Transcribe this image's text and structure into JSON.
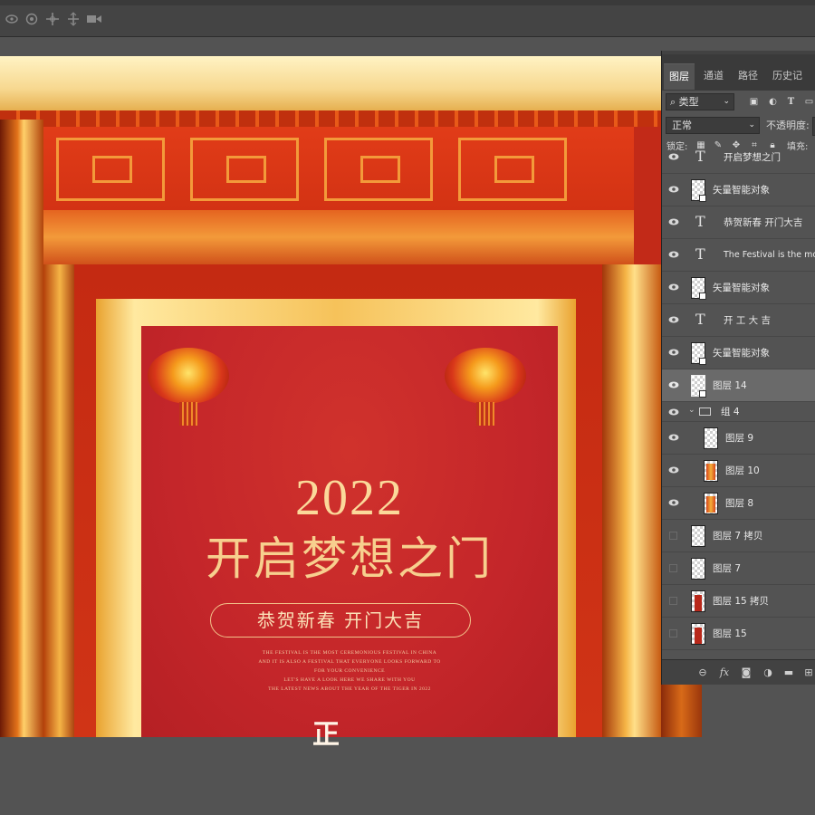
{
  "toolbar": {
    "icons": [
      "3d-orbit-icon",
      "3d-roll-icon",
      "3d-pan-icon",
      "3d-slide-icon",
      "3d-camera-icon"
    ]
  },
  "poster": {
    "year": "2022",
    "headline": "开启梦想之门",
    "subtitle": "恭贺新春  开门大吉",
    "small_copy": [
      "THE FESTIVAL IS THE MOST CEREMONIOUS FESTIVAL IN CHINA",
      "AND IT IS ALSO A FESTIVAL THAT EVERYONE LOOKS FORWARD TO",
      "FOR YOUR CONVENIENCE",
      "LET'S HAVE A LOOK HERE WE SHARE WITH YOU",
      "THE LATEST NEWS ABOUT THE YEAR OF THE TIGER IN 2022"
    ],
    "seal_char": "正"
  },
  "layers_panel": {
    "tabs": [
      "图层",
      "通道",
      "路径",
      "历史记录"
    ],
    "active_tab": "图层",
    "filter_kind": "类型",
    "blend_mode": "正常",
    "opacity_label": "不透明度:",
    "lock_label": "锁定:",
    "fill_label": "填充:",
    "layers": [
      {
        "type": "text",
        "name": "开启梦想之门",
        "visible": true
      },
      {
        "type": "smart",
        "name": "矢量智能对象",
        "visible": true
      },
      {
        "type": "text",
        "name": "恭贺新春 开门大吉",
        "visible": true
      },
      {
        "type": "text",
        "name": "The Festival is the mos",
        "visible": true
      },
      {
        "type": "smart",
        "name": "矢量智能对象",
        "visible": true
      },
      {
        "type": "text",
        "name": "开 工 大 吉",
        "visible": true
      },
      {
        "type": "smart",
        "name": "矢量智能对象",
        "visible": true
      },
      {
        "type": "smart",
        "name": "图层 14",
        "visible": true,
        "selected": true
      },
      {
        "type": "group",
        "name": "组 4",
        "visible": true
      },
      {
        "type": "pixel",
        "name": "图层 9",
        "visible": true
      },
      {
        "type": "pixel",
        "name": "图层 10",
        "visible": true
      },
      {
        "type": "pixel",
        "name": "图层 8",
        "visible": true
      },
      {
        "type": "pixel",
        "name": "图层 7 拷贝",
        "visible": false
      },
      {
        "type": "pixel",
        "name": "图层 7",
        "visible": false
      },
      {
        "type": "pixel",
        "name": "图层 15 拷贝",
        "visible": false
      },
      {
        "type": "pixel",
        "name": "图层 15",
        "visible": false
      }
    ],
    "footer_icons": [
      "link-icon",
      "fx-icon",
      "mask-icon",
      "adjustment-icon",
      "folder-icon",
      "new-layer-icon",
      "trash-icon"
    ]
  }
}
